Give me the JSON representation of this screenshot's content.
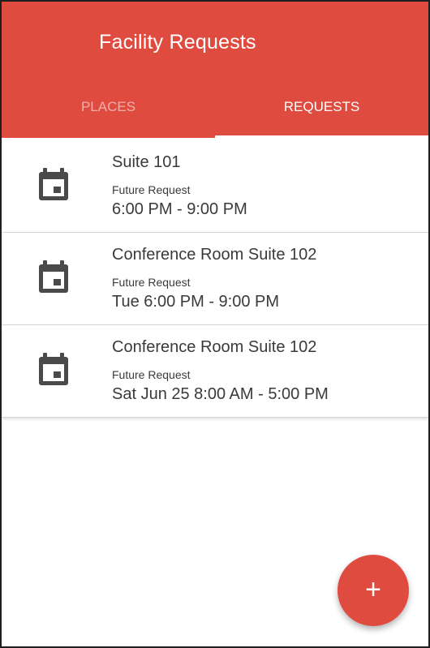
{
  "app": {
    "title": "Facility Requests",
    "accent_color": "#e04b40"
  },
  "tabs": [
    {
      "label": "PLACES",
      "active": false
    },
    {
      "label": "REQUESTS",
      "active": true
    }
  ],
  "requests": [
    {
      "title": "Suite 101",
      "status": "Future Request",
      "time": "6:00 PM - 9:00 PM",
      "icon": "calendar-icon"
    },
    {
      "title": "Conference Room Suite 102",
      "status": "Future Request",
      "time": "Tue 6:00 PM - 9:00 PM",
      "icon": "calendar-icon"
    },
    {
      "title": "Conference Room Suite 102",
      "status": "Future Request",
      "time": "Sat Jun 25 8:00 AM - 5:00 PM",
      "icon": "calendar-icon"
    }
  ],
  "fab": {
    "label": "+",
    "icon": "plus-icon"
  }
}
